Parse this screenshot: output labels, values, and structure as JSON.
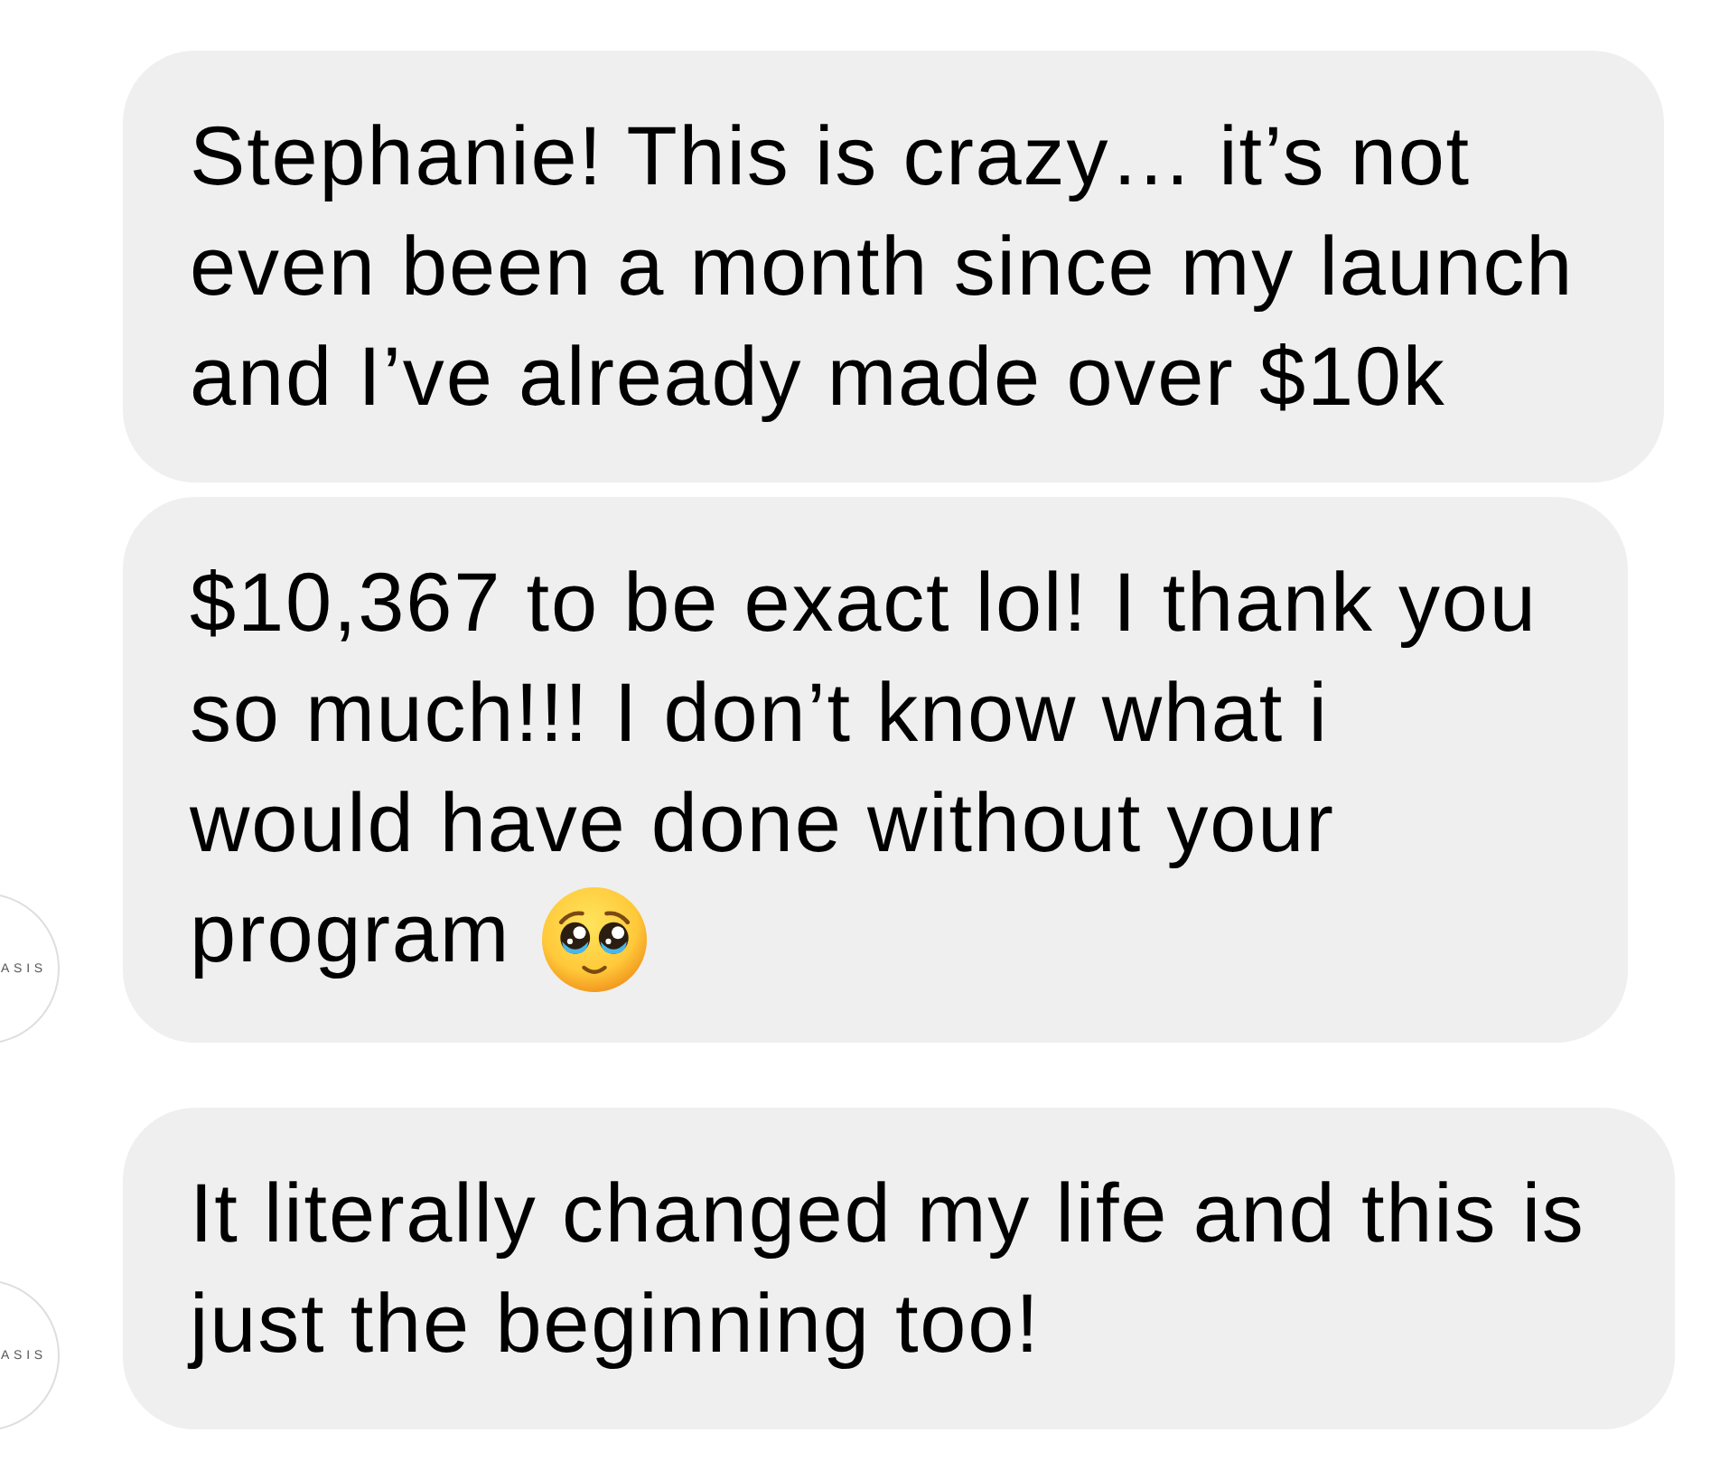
{
  "messages": [
    {
      "text": "Stephanie! This is crazy… it’s not\neven been a month since my launch\nand I’ve already made over $10k"
    },
    {
      "text": "$10,367 to be exact lol! I thank you\nso much!!! I don’t know what i\nwould have done without your\nprogram",
      "emoji": true,
      "avatar": {
        "label": "ASIS"
      }
    },
    {
      "text": "It literally changed my life and this is\njust the beginning too!",
      "avatar": {
        "label": "ASIS"
      }
    }
  ]
}
